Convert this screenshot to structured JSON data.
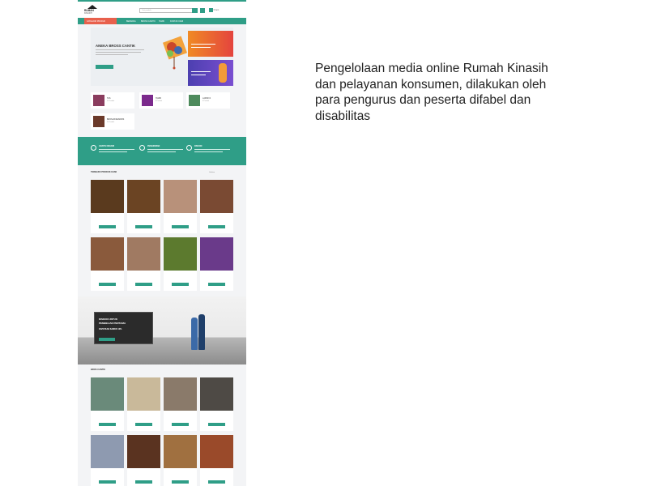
{
  "caption": {
    "line1": "Pengelolaan media online Rumah Kinasih",
    "line2": "dan pelayanan konsumen, dilakukan oleh",
    "line3": "para pengurus dan peserta difabel dan",
    "line4": "disabilitas"
  },
  "site": {
    "colors": {
      "accent": "#2f9e87",
      "nav_category": "#e8604c"
    },
    "logo": {
      "line1": "RUMAH",
      "line2": "KINASIH"
    },
    "search": {
      "placeholder": "Cari produk..."
    },
    "cart": {
      "label": "0 item"
    },
    "nav": {
      "category": "KATEGORI PRODUK",
      "items": [
        "BERANDA",
        "BROSS CANTIK",
        "HIJAB",
        "KONTAK KAMI"
      ]
    },
    "hero": {
      "title": "ANEKA BROSS CANTIK"
    },
    "category_cards": [
      {
        "name": "TAS",
        "count": "12 Produk"
      },
      {
        "name": "HIJAB",
        "count": "8 Produk"
      },
      {
        "name": "LAINNYA",
        "count": "6 Produk"
      },
      {
        "name": "BROS/AKSESORIS",
        "count": "24 Produk"
      }
    ],
    "features": [
      {
        "title": "GRATIS ONGKIR",
        "icon": "truck-icon"
      },
      {
        "title": "PENGIRIMAN",
        "icon": "box-icon"
      },
      {
        "title": "DISKON",
        "icon": "tag-icon"
      }
    ],
    "sections": {
      "new_products": "TERBARU PRODUK KAMI",
      "bross": "BROS CANTIK"
    },
    "sort_label": "Urutkan",
    "banner": {
      "line1": "DISKON UNTUK",
      "line2": "PEMBELIAN PERTAMA",
      "line3": "DAPATKAN SAMPAI 10%"
    }
  }
}
